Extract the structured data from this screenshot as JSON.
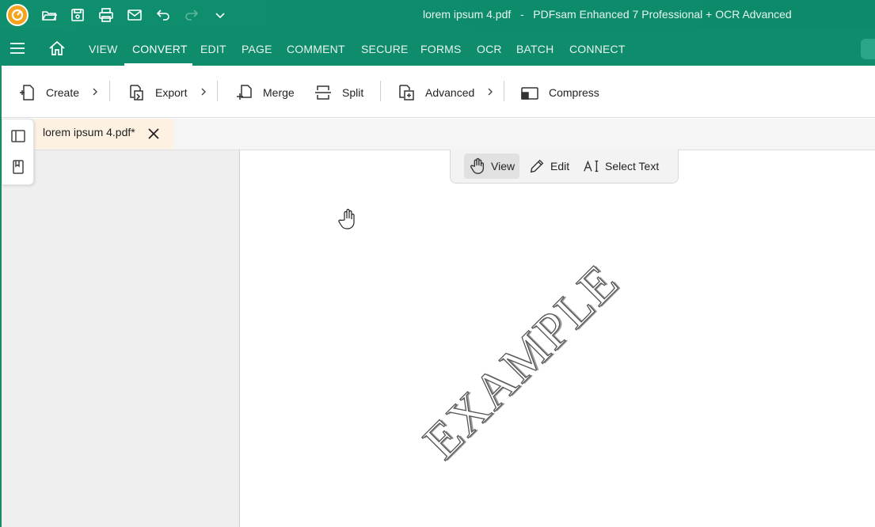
{
  "app": {
    "window_title": "lorem ipsum 4.pdf   -   PDFsam Enhanced 7 Professional + OCR Advanced",
    "logo_icon": "pdfsam-logo-icon",
    "accent_color": "#0f8c6c"
  },
  "quick_access": [
    {
      "name": "open-folder-icon"
    },
    {
      "name": "save-icon"
    },
    {
      "name": "print-icon"
    },
    {
      "name": "mail-icon"
    },
    {
      "name": "undo-icon"
    },
    {
      "name": "redo-icon",
      "disabled": true
    },
    {
      "name": "chevron-down-icon"
    }
  ],
  "menu": {
    "items": [
      "VIEW",
      "CONVERT",
      "EDIT",
      "PAGE",
      "COMMENT",
      "SECURE",
      "FORMS",
      "OCR",
      "BATCH",
      "CONNECT"
    ],
    "active": "CONVERT"
  },
  "ribbon": {
    "create": "Create",
    "export": "Export",
    "merge": "Merge",
    "split": "Split",
    "advanced": "Advanced",
    "compress": "Compress"
  },
  "tabs": {
    "document": "lorem ipsum 4.pdf*"
  },
  "modes": {
    "view": "View",
    "edit": "Edit",
    "select_text": "Select Text",
    "active": "View"
  },
  "document": {
    "watermark": "EXAMPLE"
  }
}
